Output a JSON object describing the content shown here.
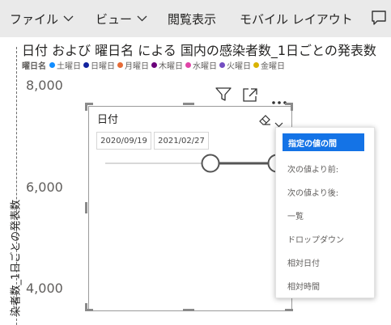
{
  "menu": {
    "file": "ファイル",
    "view": "ビュー",
    "reading_view": "閲覧表示",
    "mobile_layout": "モバイル レイアウト"
  },
  "chart": {
    "title": "日付 および 曜日名 による 国内の感染者数_1日ごとの発表数",
    "legend_title": "曜日名",
    "legend": [
      {
        "label": "土曜日",
        "color": "#118dff"
      },
      {
        "label": "日曜日",
        "color": "#12239e"
      },
      {
        "label": "月曜日",
        "color": "#e66c37"
      },
      {
        "label": "木曜日",
        "color": "#6b007b"
      },
      {
        "label": "水曜日",
        "color": "#e044a7"
      },
      {
        "label": "火曜日",
        "color": "#744ec2"
      },
      {
        "label": "金曜日",
        "color": "#d9b300"
      }
    ],
    "y_ticks": [
      "8,000",
      "6,000",
      "4,000"
    ],
    "y_label": "染者数_1日ごとの発表数"
  },
  "slicer": {
    "title": "日付",
    "start_date": "2020/09/19",
    "end_date": "2021/02/27"
  },
  "dropdown": {
    "selected": "指定の値の間",
    "items": [
      "次の値より前:",
      "次の値より後:",
      "一覧",
      "ドロップダウン",
      "相対日付",
      "相対時間"
    ]
  },
  "colors": {
    "menubar_bg": "#eaeaea",
    "selected_bg": "#1473e6"
  }
}
